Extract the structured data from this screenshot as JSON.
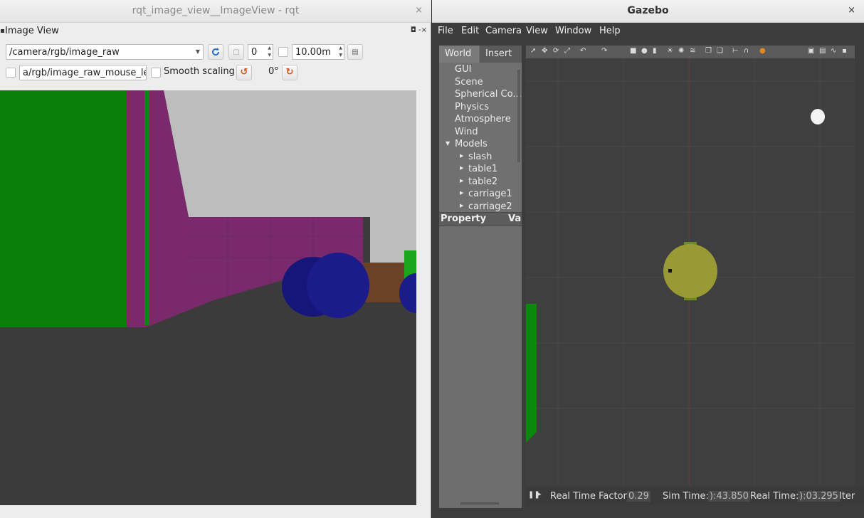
{
  "rqt": {
    "title": "rqt_image_view__ImageView - rqt",
    "close": "×",
    "dock_title": "Image View",
    "dock_icons": "◘ -×",
    "topic": "/camera/rgb/image_raw",
    "spin_value": "0",
    "max_range": "10.00m",
    "mouse_topic": "a/rgb/image_raw_mouse_left",
    "smooth_scaling_label": "Smooth scaling",
    "rotation_label": "0°"
  },
  "gazebo": {
    "title": "Gazebo",
    "close": "×",
    "menu": [
      "File",
      "Edit",
      "Camera",
      "View",
      "Window",
      "Help"
    ],
    "tabs": [
      "World",
      "Insert"
    ],
    "tree": {
      "items": [
        "GUI",
        "Scene",
        "Spherical Co...",
        "Physics",
        "Atmosphere",
        "Wind",
        "Models"
      ],
      "models": [
        "slash",
        "table1",
        "table2",
        "carriage1",
        "carriage2"
      ]
    },
    "property_header": "Property",
    "value_header": "Va",
    "status": {
      "real_time_factor_label": "Real Time Factor:",
      "real_time_factor": "0.29",
      "sim_time_label": "Sim Time:",
      "sim_time": "):43.850",
      "real_time_label": "Real Time:",
      "real_time": "):03.295",
      "iterations_label": "Iter"
    }
  }
}
